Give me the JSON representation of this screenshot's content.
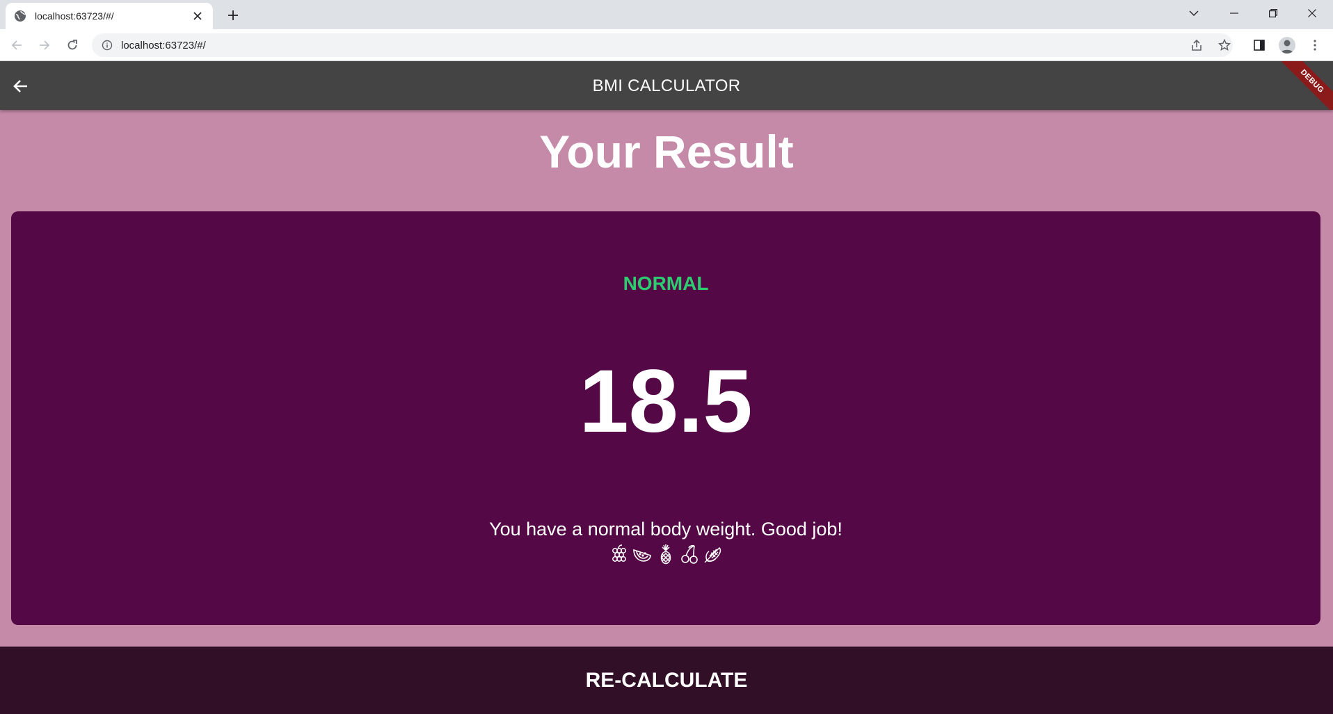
{
  "browser": {
    "tab_title": "localhost:63723/#/",
    "url": "localhost:63723/#/"
  },
  "app": {
    "title": "BMI CALCULATOR",
    "debug_label": "DEBUG",
    "heading": "Your Result",
    "result": {
      "status": "NORMAL",
      "bmi": "18.5",
      "message": "You have a normal body weight. Good job!",
      "icons": [
        "grapes-icon",
        "watermelon-icon",
        "pineapple-icon",
        "cherries-icon",
        "corn-icon"
      ]
    },
    "recalculate_label": "RE-CALCULATE"
  },
  "colors": {
    "page_background": "#c48aa8",
    "card_background": "#540845",
    "appbar": "#444444",
    "status_green": "#2ecc71",
    "bottom_button": "#300f27"
  }
}
